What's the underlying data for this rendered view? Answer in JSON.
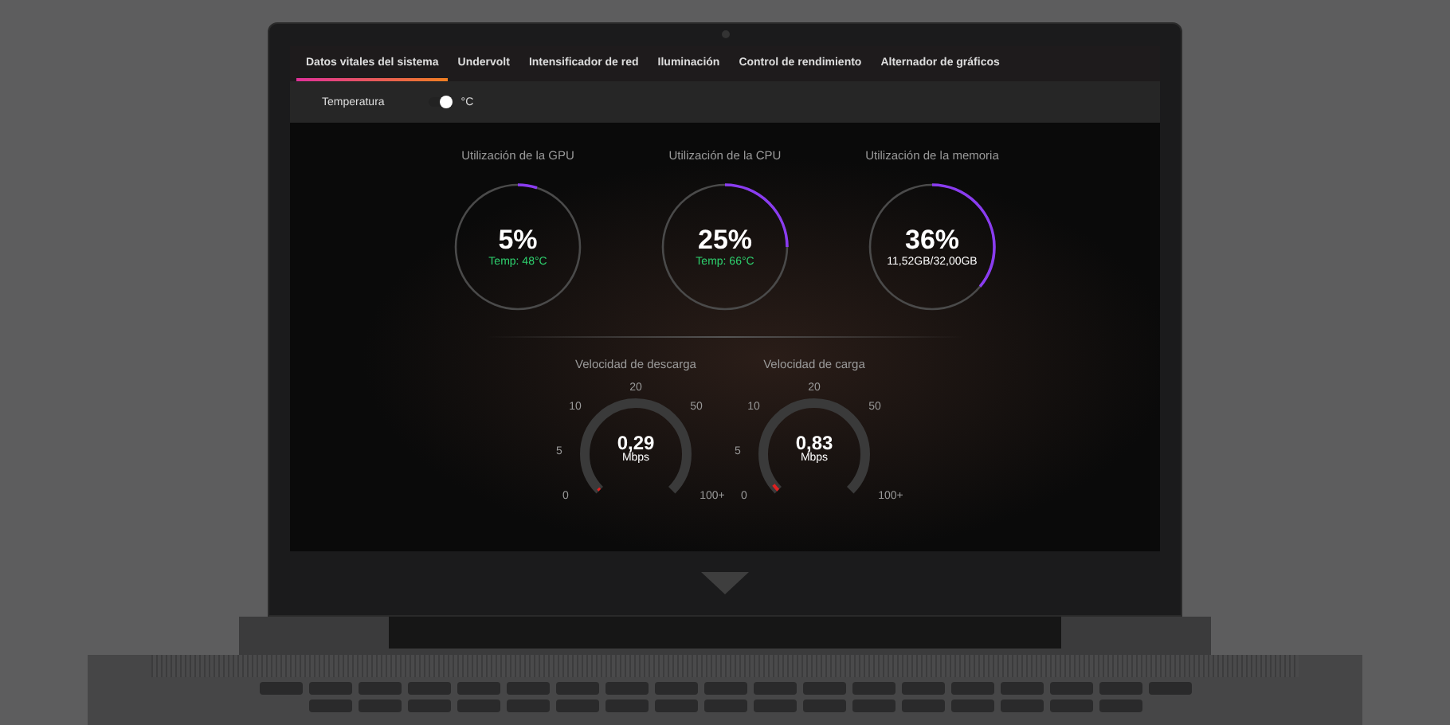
{
  "tabs": [
    {
      "label": "Datos vitales del sistema",
      "selected": true
    },
    {
      "label": "Undervolt",
      "selected": false
    },
    {
      "label": "Intensificador de red",
      "selected": false
    },
    {
      "label": "Iluminación",
      "selected": false
    },
    {
      "label": "Control de rendimiento",
      "selected": false
    },
    {
      "label": "Alternador de gráficos",
      "selected": false
    }
  ],
  "temperature": {
    "label": "Temperatura",
    "unit": "°C",
    "on": true
  },
  "usage": [
    {
      "title": "Utilización de la GPU",
      "value": "5%",
      "detail": "Temp: 48°C",
      "kind": "temp",
      "level": 0.05
    },
    {
      "title": "Utilización de la CPU",
      "value": "25%",
      "detail": "Temp: 66°C",
      "kind": "temp",
      "level": 0.25
    },
    {
      "title": "Utilización de la memoria",
      "value": "36%",
      "detail": "11,52GB/32,00GB",
      "kind": "memory",
      "level": 0.36
    }
  ],
  "speeds": [
    {
      "title": "Velocidad de descarga",
      "value": "0,29",
      "unit": "Mbps",
      "level": 0.01,
      "ticks": [
        "0",
        "5",
        "10",
        "20",
        "50",
        "100+"
      ]
    },
    {
      "title": "Velocidad de carga",
      "value": "0,83",
      "unit": "Mbps",
      "level": 0.03,
      "ticks": [
        "0",
        "5",
        "10",
        "20",
        "50",
        "100+"
      ]
    }
  ]
}
